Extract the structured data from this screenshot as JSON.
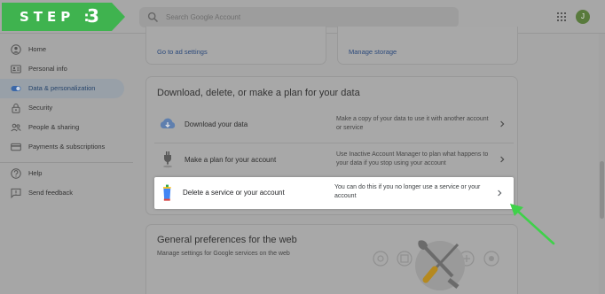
{
  "step_badge": {
    "label": "STEP :",
    "number": "3",
    "color": "#3fb34f"
  },
  "header": {
    "search_placeholder": "Search Google Account",
    "avatar_initial": "J",
    "icons": [
      "search-icon",
      "apps-grid-icon"
    ]
  },
  "sidebar": {
    "items": [
      {
        "label": "Home",
        "icon": "home-icon",
        "active": false
      },
      {
        "label": "Personal info",
        "icon": "id-card-icon",
        "active": false
      },
      {
        "label": "Data & personalization",
        "icon": "toggle-icon",
        "active": true
      },
      {
        "label": "Security",
        "icon": "lock-icon",
        "active": false
      },
      {
        "label": "People & sharing",
        "icon": "people-icon",
        "active": false
      },
      {
        "label": "Payments & subscriptions",
        "icon": "credit-card-icon",
        "active": false
      }
    ],
    "footer_items": [
      {
        "label": "Help",
        "icon": "help-icon"
      },
      {
        "label": "Send feedback",
        "icon": "feedback-icon"
      }
    ]
  },
  "top_cards": {
    "ad_settings_link": "Go to ad settings",
    "manage_storage_link": "Manage storage"
  },
  "download_section": {
    "title": "Download, delete, or make a plan for your data",
    "rows": [
      {
        "label": "Download your data",
        "description": "Make a copy of your data to use it with another account or service",
        "icon": "cloud-download-icon"
      },
      {
        "label": "Make a plan for your account",
        "description": "Use Inactive Account Manager to plan what happens to your data if you stop using your account",
        "icon": "plug-icon"
      },
      {
        "label": "Delete a service or your account",
        "description": "You can do this if you no longer use a service or your account",
        "icon": "trash-can-icon"
      }
    ]
  },
  "preferences_section": {
    "title": "General preferences for the web",
    "subtitle": "Manage settings for Google services on the web"
  },
  "colors": {
    "highlight_bg": "#ffffff",
    "arrow": "#3fd14a",
    "active_nav": "#98a0a8"
  }
}
